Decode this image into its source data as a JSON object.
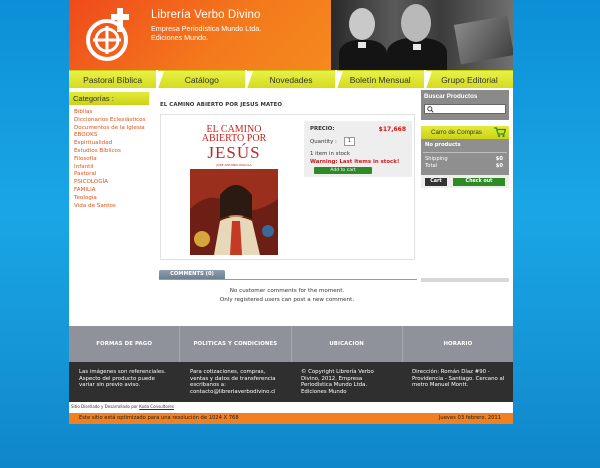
{
  "header": {
    "brand_name": "Librería Verbo Divino",
    "brand_sub_1": "Empresa Periodística Mundo Ltda.",
    "brand_sub_2": "Ediciones Mundo."
  },
  "nav": {
    "items": [
      "Pastoral Bíblica",
      "Catálogo",
      "Novedades",
      "Boletín Mensual",
      "Grupo Editorial"
    ]
  },
  "categories": {
    "title": "Categorías :",
    "items": [
      "Biblias",
      "Diccionarios Eclesiásticos",
      "Documentos de la Iglesia",
      "EBOOKS",
      "Espiritualidad",
      "Estudios Bíblicos",
      "Filosofía",
      "Infantil",
      "Pastoral",
      "PSICOLOGÍA",
      "FAMILIA",
      "Teología",
      "Vida de Santos"
    ]
  },
  "product": {
    "title": "EL CAMINO ABIERTO POR JESUS MATEO",
    "cover_line1": "EL CAMINO",
    "cover_line2": "ABIERTO POR",
    "cover_line3": "JESÚS",
    "cover_author": "JOSÉ ANTONIO PAGOLA",
    "price_label": "PRECIO:",
    "price_value": "$17,668",
    "quantity_label": "Quantity :",
    "quantity_value": "1",
    "stock_text": "1 item in stock",
    "warning_text": "Warning: Last items in stock!",
    "add_to_cart": "Add to cart"
  },
  "comments": {
    "tab_label": "COMMENTS (0)",
    "no_comments": "No customer comments for the moment.",
    "only_registered": "Only registered users can post a new comment."
  },
  "search": {
    "title": "Buscar Productos",
    "placeholder": ""
  },
  "cart": {
    "title": "Carro de Compras",
    "empty_text": "No products",
    "shipping_label": "Shipping",
    "shipping_value": "$0",
    "total_label": "Total",
    "total_value": "$0",
    "cart_button": "Cart",
    "checkout_button": "Check out"
  },
  "footer": {
    "columns": [
      "FORMAS DE PAGO",
      "POLITICAS Y CONDICIONES",
      "UBICACION",
      "HORARIO"
    ],
    "info": [
      "Las imágenes son referenciales. Aspecto del producto puede variar sin previo aviso.",
      "Para cotizaciones, compras, ventas y datos de transferencia escribanos a: contacto@libreriaverbodivino.cl",
      "© Copyright Librería Verbo Divino, 2012. Empresa Periodística Mundo Ltda. Ediciones Mundo",
      "Dirección: Román Díaz #90 - Providencia - Santiago. Cercano al metro Manuel Montt."
    ],
    "credit_prefix": "Sitio Diseñado y Desarrollado por",
    "credit_link": "Koda Consultores",
    "bottom_left": "Este sitio está optimizado para una resolución de 1024 X 768",
    "bottom_right": "Jueves 03 febrero, 2011"
  },
  "colors": {
    "orange": "#f47a1c",
    "lime": "#d3dc1c",
    "price_red": "#d41313",
    "green_button": "#2f8a26",
    "background_blue": "#1aa6e6"
  }
}
